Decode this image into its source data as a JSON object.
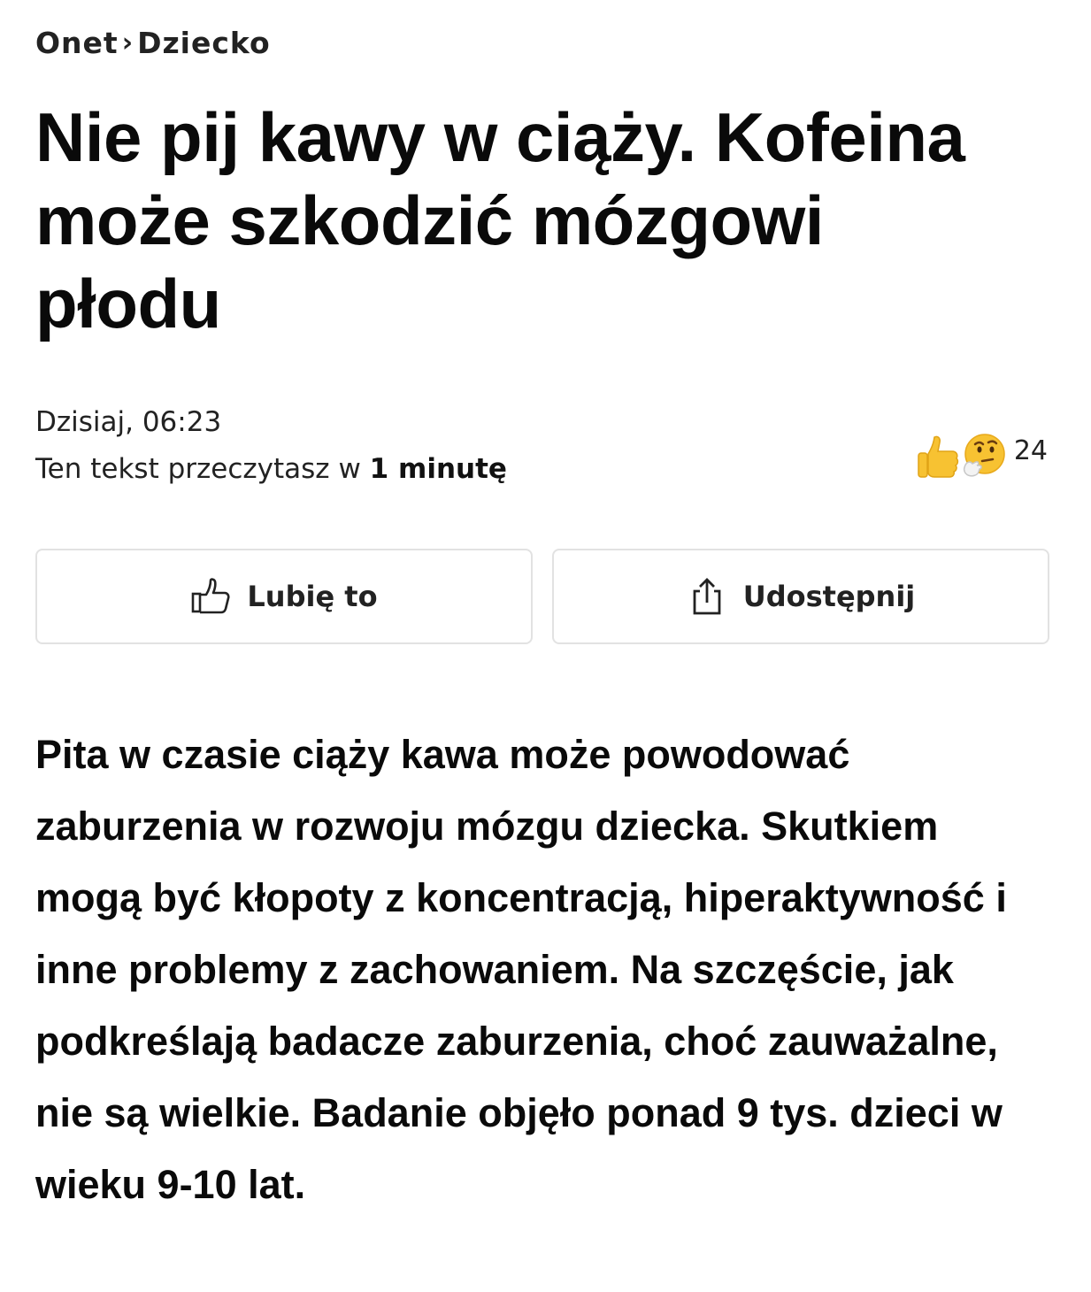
{
  "breadcrumb": {
    "site": "Onet",
    "separator": "›",
    "section": "Dziecko"
  },
  "article": {
    "title": "Nie pij kawy w ciąży. Kofeina może szkodzić mózgowi płodu",
    "date": "Dzisiaj, 06:23",
    "read_time_prefix": "Ten tekst przeczytasz w ",
    "read_time_value": "1 minutę",
    "lead": "Pita w czasie ciąży kawa może powodować zaburzenia w rozwoju mózgu dziecka. Skutkiem mogą być kłopoty z koncentracją, hiperaktywność i inne problemy z zachowaniem. Na szczęście, jak podkreślają badacze zaburzenia, choć zauważalne, nie są wielkie. Badanie objęło ponad 9 tys. dzieci w wieku 9-10 lat."
  },
  "reactions": {
    "icons": [
      "thumbs-up-emoji",
      "thinking-face-emoji"
    ],
    "count": "24"
  },
  "actions": {
    "like_label": "Lubię to",
    "like_icon": "thumbs-up-outline-icon",
    "share_label": "Udostępnij",
    "share_icon": "share-icon"
  },
  "colors": {
    "text": "#111111",
    "border": "#e2e2e2",
    "emoji_yellow": "#f7c232"
  }
}
